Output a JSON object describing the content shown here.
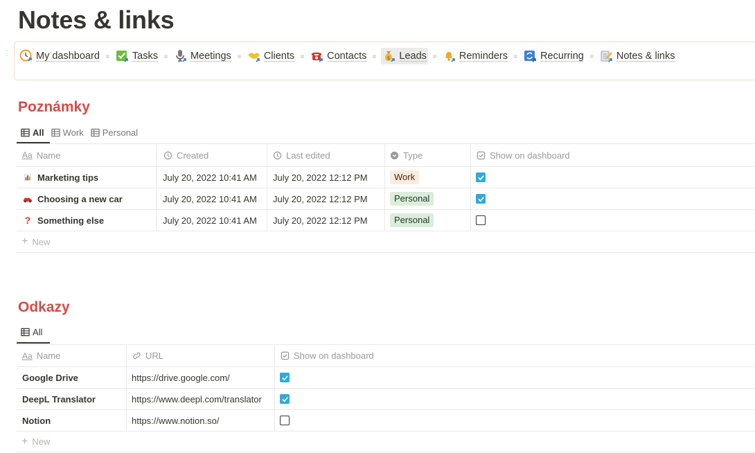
{
  "page": {
    "title": "Notes & links"
  },
  "nav": {
    "items": [
      {
        "label": "My dashboard",
        "icon": "clock-icon"
      },
      {
        "label": "Tasks",
        "icon": "check-square-icon"
      },
      {
        "label": "Meetings",
        "icon": "microphone-icon"
      },
      {
        "label": "Clients",
        "icon": "handshake-icon"
      },
      {
        "label": "Contacts",
        "icon": "telephone-icon"
      },
      {
        "label": "Leads",
        "icon": "money-bag-icon"
      },
      {
        "label": "Reminders",
        "icon": "bell-icon"
      },
      {
        "label": "Recurring",
        "icon": "repeat-icon"
      },
      {
        "label": "Notes & links",
        "icon": "memo-icon"
      }
    ]
  },
  "notes": {
    "heading": "Poznámky",
    "tabs": [
      "All",
      "Work",
      "Personal"
    ],
    "columns": {
      "name": "Name",
      "created": "Created",
      "edited": "Last edited",
      "type": "Type",
      "show": "Show on dashboard"
    },
    "rows": [
      {
        "name": "Marketing tips",
        "icon": "bar-chart-icon",
        "created": "July 20, 2022 10:41 AM",
        "edited": "July 20, 2022 12:12 PM",
        "type": "Work",
        "show": true
      },
      {
        "name": "Choosing a new car",
        "icon": "car-icon",
        "created": "July 20, 2022 10:41 AM",
        "edited": "July 20, 2022 12:12 PM",
        "type": "Personal",
        "show": true
      },
      {
        "name": "Something else",
        "icon": "question-mark-icon",
        "created": "July 20, 2022 10:41 AM",
        "edited": "July 20, 2022 12:12 PM",
        "type": "Personal",
        "show": false
      }
    ],
    "new_label": "New"
  },
  "links": {
    "heading": "Odkazy",
    "tabs": [
      "All"
    ],
    "columns": {
      "name": "Name",
      "url": "URL",
      "show": "Show on dashboard"
    },
    "rows": [
      {
        "name": "Google Drive",
        "url": "https://drive.google.com/",
        "show": true
      },
      {
        "name": "DeepL Translator",
        "url": "https://www.deepl.com/translator",
        "show": true
      },
      {
        "name": "Notion",
        "url": "https://www.notion.so/",
        "show": false
      }
    ],
    "new_label": "New"
  },
  "colors": {
    "accent_heading": "#d44c47",
    "checkbox_on": "#2eaadc",
    "tag_work": "#fbecdd",
    "tag_personal": "#dbeddb"
  }
}
